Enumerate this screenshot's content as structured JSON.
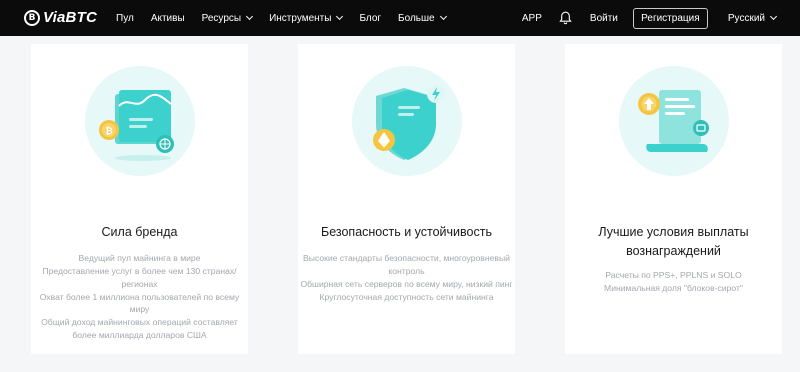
{
  "nav": {
    "logo_text": "ViaBTC",
    "logo_mark": "B",
    "items": [
      {
        "label": "Пул"
      },
      {
        "label": "Активы"
      },
      {
        "label": "Ресурсы"
      },
      {
        "label": "Инструменты"
      },
      {
        "label": "Блог"
      },
      {
        "label": "Больше"
      }
    ],
    "app_label": "APP",
    "bell_icon": "bell-icon",
    "login_label": "Войти",
    "register_label": "Регистрация",
    "language_label": "Русский"
  },
  "colors": {
    "nav_bg": "#0b0b0c",
    "accent_teal": "#3cd1cc",
    "coin_gold": "#f5c542",
    "page_bg": "#f5f6f8"
  },
  "cards": [
    {
      "icon": "brand-chart-coin-illustration",
      "title": "Сила бренда",
      "lines": [
        "Ведущий пул майнинга в мире",
        "Предоставление услуг в более чем 130 странах/ регионах",
        "Охват более 1 миллиона пользователей по всему миру",
        "Общий доход майнинговых операций составляет более миллиарда долларов США"
      ]
    },
    {
      "icon": "security-shield-illustration",
      "title": "Безопасность и устойчивость",
      "lines": [
        "Высокие стандарты безопасности, многоуровневый контроль",
        "Обширная сеть серверов по всему миру, низкий пинг",
        "Круглосуточная доступность сети майнинга"
      ]
    },
    {
      "icon": "payout-scroll-illustration",
      "title": "Лучшие условия выплаты вознаграждений",
      "lines": [
        "Расчеты по PPS+, PPLNS и SOLO",
        "Минимальная доля \"блоков-сирот\""
      ]
    }
  ]
}
